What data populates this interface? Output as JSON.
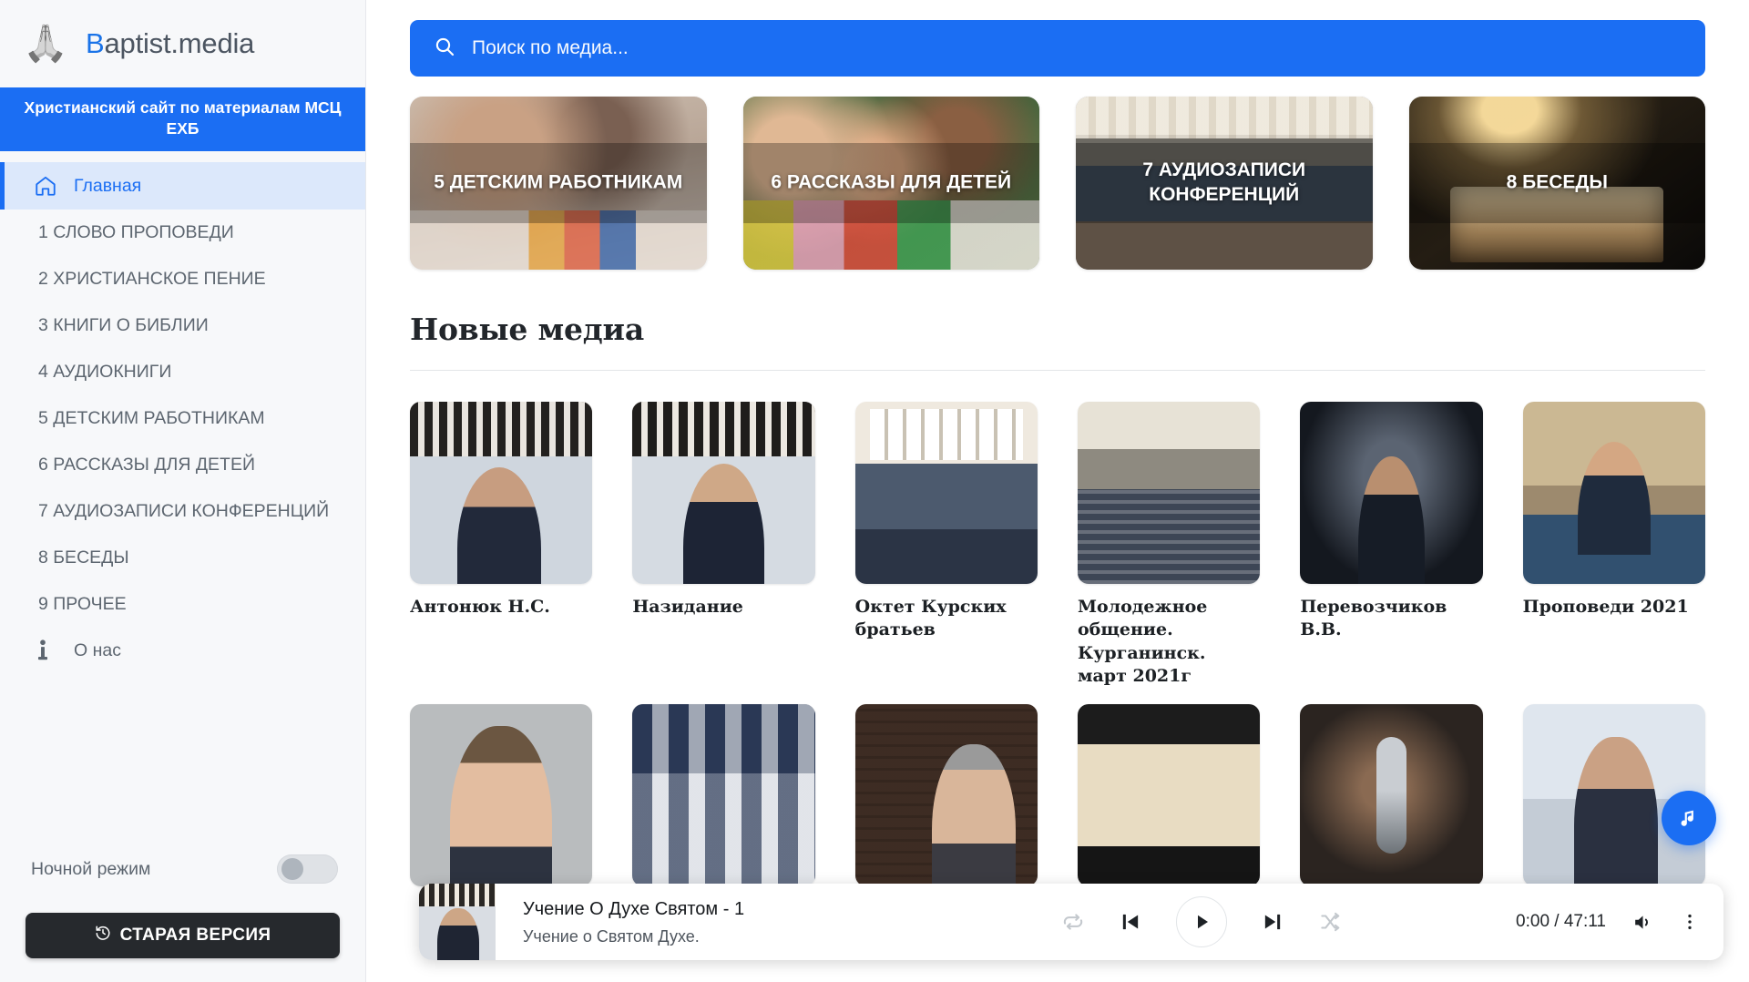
{
  "brand": {
    "logo_icon": "praying-hands-icon",
    "name_prefix": "B",
    "name_rest": "aptist.media",
    "subtitle": "Христианский сайт по материалам МСЦ ЕХБ"
  },
  "sidebar": {
    "items": [
      {
        "label": "Главная",
        "icon": "home-icon",
        "active": true
      },
      {
        "label": "1 СЛОВО ПРОПОВЕДИ",
        "icon": "",
        "active": false
      },
      {
        "label": "2 ХРИСТИАНСКОЕ ПЕНИЕ",
        "icon": "",
        "active": false
      },
      {
        "label": "3 КНИГИ О БИБЛИИ",
        "icon": "",
        "active": false
      },
      {
        "label": "4 АУДИОКНИГИ",
        "icon": "",
        "active": false
      },
      {
        "label": "5 ДЕТСКИМ РАБОТНИКАМ",
        "icon": "",
        "active": false
      },
      {
        "label": "6 РАССКАЗЫ ДЛЯ ДЕТЕЙ",
        "icon": "",
        "active": false
      },
      {
        "label": "7 АУДИОЗАПИСИ КОНФЕРЕНЦИЙ",
        "icon": "",
        "active": false
      },
      {
        "label": "8 БЕСЕДЫ",
        "icon": "",
        "active": false
      },
      {
        "label": "9 ПРОЧЕЕ",
        "icon": "",
        "active": false
      },
      {
        "label": "О нас",
        "icon": "info-icon",
        "active": false
      }
    ],
    "night_mode_label": "Ночной режим",
    "night_mode_on": false,
    "old_version_label": "СТАРАЯ ВЕРСИЯ",
    "old_version_icon": "history-clock-icon"
  },
  "search": {
    "placeholder": "Поиск по медиа...",
    "value": "",
    "icon": "search-icon"
  },
  "categories": [
    {
      "label": "5 ДЕТСКИМ РАБОТНИКАМ",
      "art": "art-kids1"
    },
    {
      "label": "6 РАССКАЗЫ ДЛЯ ДЕТЕЙ",
      "art": "art-kids2"
    },
    {
      "label": "7 АУДИОЗАПИСИ КОНФЕРЕНЦИЙ",
      "art": "art-hall"
    },
    {
      "label": "8 БЕСЕДЫ",
      "art": "art-bible"
    }
  ],
  "new_media": {
    "heading": "Новые медиа",
    "items": [
      {
        "title": "Антонюк Н.С.",
        "art": "t-pulpit1"
      },
      {
        "title": "Назидание",
        "art": "t-pulpit2"
      },
      {
        "title": "Октет Курских братьев",
        "art": "t-choir"
      },
      {
        "title": "Молодежное общение. Курганинск. март 2021г",
        "art": "t-congr"
      },
      {
        "title": "Перевозчиков В.В.",
        "art": "t-dark"
      },
      {
        "title": "Проповеди 2021",
        "art": "t-desk"
      },
      {
        "title": "",
        "art": "t-gray"
      },
      {
        "title": "",
        "art": "t-crowd"
      },
      {
        "title": "",
        "art": "t-brick"
      },
      {
        "title": "",
        "art": "t-cream"
      },
      {
        "title": "",
        "art": "t-mic"
      },
      {
        "title": "",
        "art": "t-light"
      }
    ]
  },
  "player": {
    "title": "Учение О Духе Святом - 1",
    "subtitle": "Учение о Святом Духе.",
    "time": "0:00 / 47:11",
    "current_time": "0:00",
    "duration": "47:11",
    "repeat_icon": "repeat-icon",
    "prev_icon": "skip-previous-icon",
    "play_icon": "play-icon",
    "next_icon": "skip-next-icon",
    "shuffle_icon": "shuffle-icon",
    "volume_icon": "volume-icon",
    "more_icon": "more-vertical-icon"
  },
  "fab": {
    "icon": "music-note-icon"
  },
  "colors": {
    "accent": "#1b6ef3",
    "sidebar_bg": "#f7f8fa",
    "active_nav_bg": "#dce8fb",
    "dark_button": "#26292d"
  }
}
